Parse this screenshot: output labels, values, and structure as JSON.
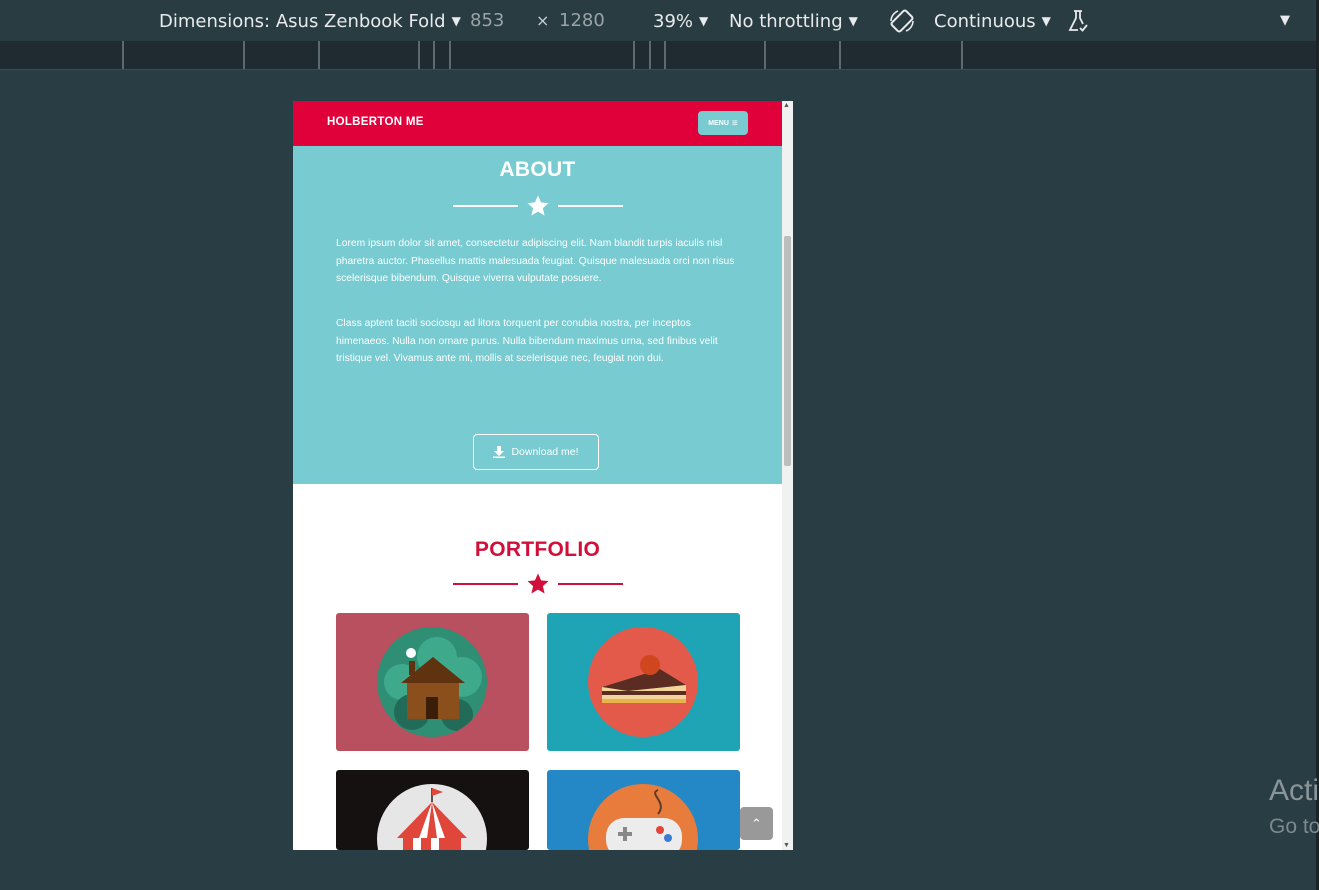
{
  "devtools": {
    "dimensions_label": "Dimensions: Asus Zenbook Fold",
    "width_value": "853",
    "times_symbol": "×",
    "height_value": "1280",
    "zoom": "39%",
    "throttling": "No throttling",
    "mode": "Continuous",
    "caret": "▼"
  },
  "site": {
    "brand": "HOLBERTON ME",
    "menu_label": "MENU",
    "menu_glyph": "≡",
    "about": {
      "title": "ABOUT",
      "paragraphs": [
        "Lorem ipsum dolor sit amet, consectetur adipiscing elit. Nam blandit turpis iaculis nisl pharetra auctor. Phasellus mattis malesuada feugiat. Quisque malesuada orci non risus scelerisque bibendum. Quisque viverra vulputate posuere.",
        "Class aptent taciti sociosqu ad litora torquent per conubia nostra, per inceptos himenaeos. Nulla non ornare purus. Nulla bibendum maximus urna, sed finibus velit tristique vel. Vivamus ante mi, mollis at scelerisque nec, feugiat non dui."
      ],
      "download_label": "Download me!"
    },
    "portfolio": {
      "title": "PORTFOLIO",
      "tiles": [
        {
          "name": "cabin",
          "bg": "#b9505f",
          "circle": "#2e8f75"
        },
        {
          "name": "cake",
          "bg": "#1fa4b5",
          "circle": "#e35a4b"
        },
        {
          "name": "circus",
          "bg": "#161111",
          "circle": "#e6e6e6"
        },
        {
          "name": "game-controller",
          "bg": "#2388c5",
          "circle": "#e77c3c"
        }
      ]
    },
    "back_to_top_glyph": "⌃"
  },
  "colors": {
    "nav": "#e0003a",
    "about_bg": "#77cbd1",
    "accent_red": "#d0103a"
  },
  "watermark": {
    "line1": "Acti",
    "line2": "Go to"
  }
}
